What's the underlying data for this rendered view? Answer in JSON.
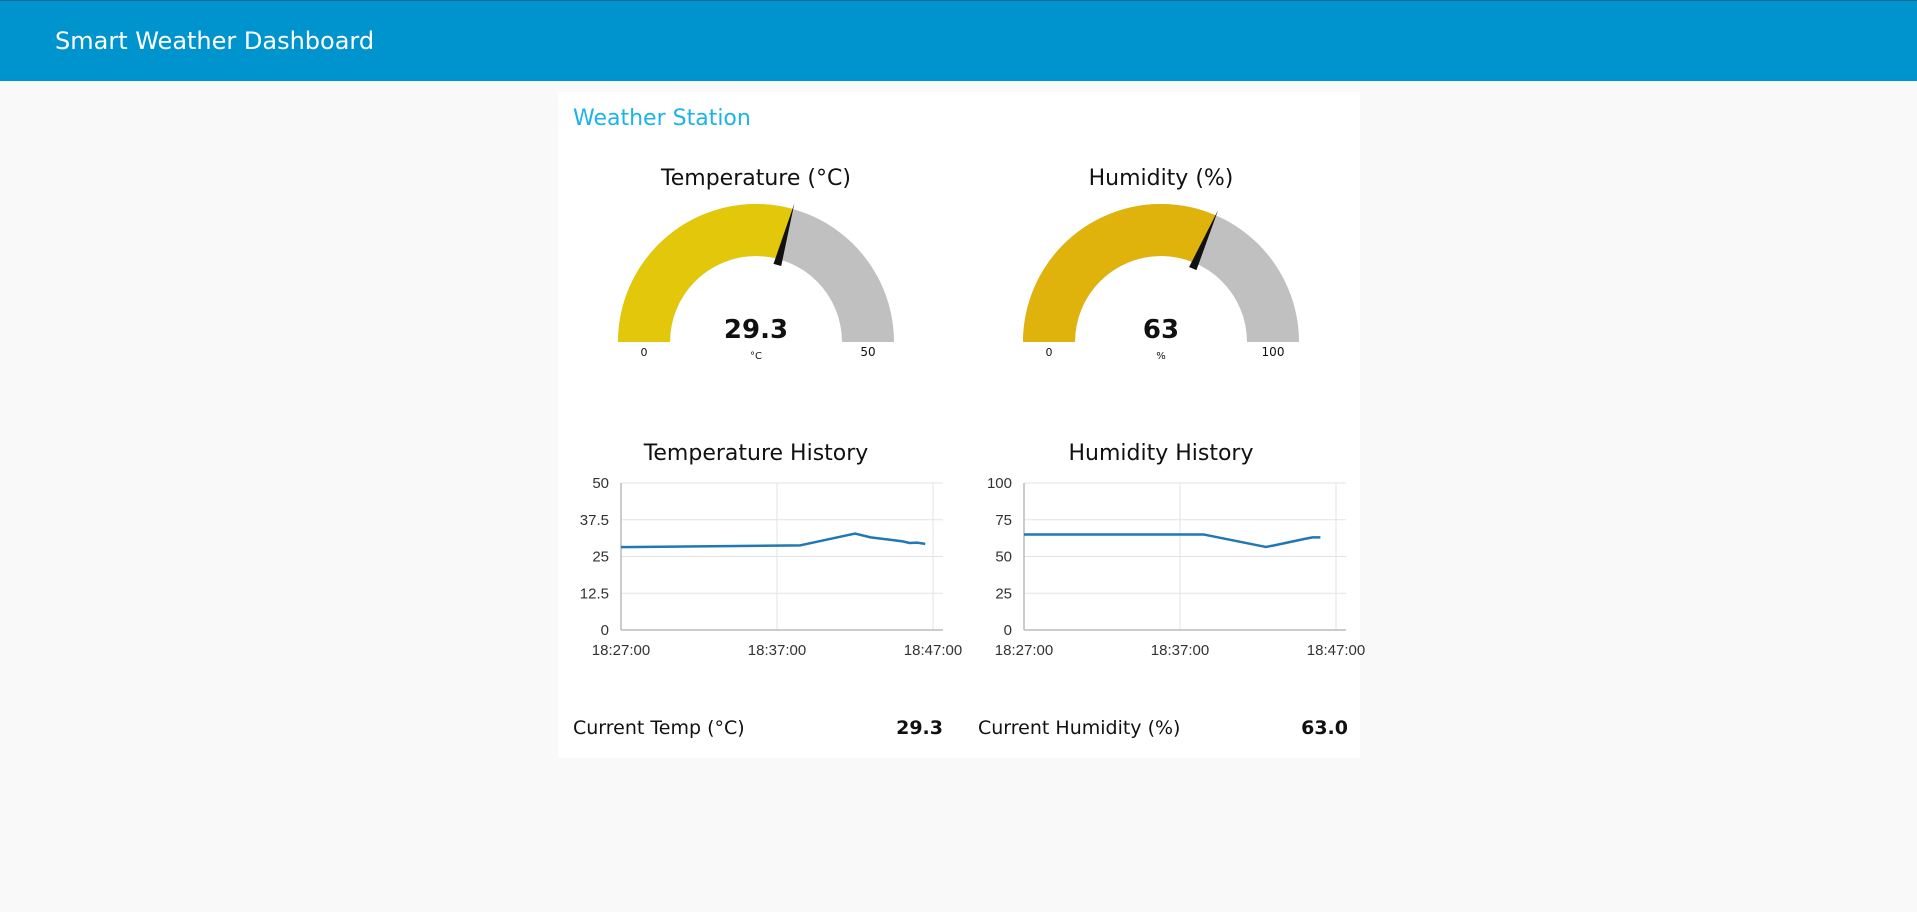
{
  "app": {
    "title": "Smart Weather Dashboard"
  },
  "group": {
    "title": "Weather Station"
  },
  "gauges": [
    {
      "title": "Temperature (°C)",
      "value": 29.3,
      "value_text": "29.3",
      "unit": "°C",
      "min": 0,
      "max": 50,
      "min_text": "0",
      "max_text": "50",
      "color": "#e2c70a"
    },
    {
      "title": "Humidity (%)",
      "value": 63,
      "value_text": "63",
      "unit": "%",
      "min": 0,
      "max": 100,
      "min_text": "0",
      "max_text": "100",
      "color": "#e0b30c"
    }
  ],
  "charts": {
    "temperature": {
      "title": "Temperature History",
      "chart_data": {
        "type": "line",
        "title": "Temperature History",
        "ylim": [
          0,
          50
        ],
        "yticks": [
          "0",
          "12.5",
          "25",
          "37.5",
          "50"
        ],
        "xticks": [
          "18:27:00",
          "18:37:00",
          "18:47:00"
        ],
        "x": [
          "18:27:00",
          "18:38:30",
          "18:42:00",
          "18:43:00",
          "18:45:00",
          "18:45:30",
          "18:46:00",
          "18:46:30"
        ],
        "values": [
          28.2,
          28.8,
          32.8,
          31.5,
          30.2,
          29.6,
          29.7,
          29.3
        ],
        "color": "#1f77b4",
        "grid": true
      }
    },
    "humidity": {
      "title": "Humidity History",
      "chart_data": {
        "type": "line",
        "title": "Humidity History",
        "ylim": [
          0,
          100
        ],
        "yticks": [
          "0",
          "25",
          "50",
          "75",
          "100"
        ],
        "xticks": [
          "18:27:00",
          "18:37:00",
          "18:47:00"
        ],
        "x": [
          "18:27:00",
          "18:38:30",
          "18:42:30",
          "18:43:00",
          "18:45:00",
          "18:45:30",
          "18:46:00"
        ],
        "values": [
          65,
          65,
          56.5,
          57.5,
          62,
          63,
          63
        ],
        "color": "#1f77b4",
        "grid": true
      }
    }
  },
  "readouts": [
    {
      "label": "Current Temp (°C)",
      "value": "29.3"
    },
    {
      "label": "Current Humidity (%)",
      "value": "63.0"
    }
  ]
}
